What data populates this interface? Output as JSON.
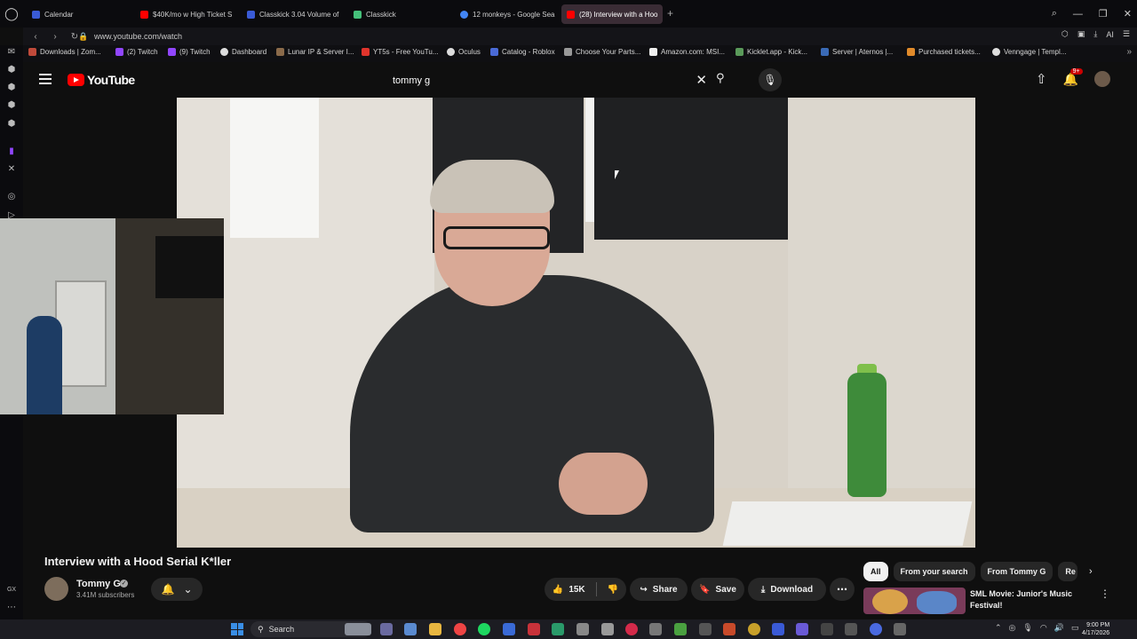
{
  "browser": {
    "tabs": [
      {
        "label": "Calendar",
        "color": "#3a5bd6"
      },
      {
        "label": "$40K/mo w High Ticket S",
        "color": "#ff0000"
      },
      {
        "label": "Classkick 3.04 Volume of",
        "color": "#3a5bd6"
      },
      {
        "label": "Classkick",
        "color": "#45c07a"
      },
      {
        "label": "12 monkeys - Google Sea",
        "color": "#4285f4"
      },
      {
        "label": "(28) Interview with a Hoo",
        "color": "#ff0000"
      }
    ],
    "url": "www.youtube.com/watch",
    "ai_label": "AI",
    "bookmarks": [
      {
        "label": "Downloads | Zom..."
      },
      {
        "label": "(2) Twitch"
      },
      {
        "label": "(9) Twitch"
      },
      {
        "label": "Dashboard"
      },
      {
        "label": "Lunar IP & Server I..."
      },
      {
        "label": "YT5s - Free YouTu..."
      },
      {
        "label": "Oculus"
      },
      {
        "label": "Catalog - Roblox"
      },
      {
        "label": "Choose Your Parts..."
      },
      {
        "label": "Amazon.com: MSI..."
      },
      {
        "label": "Kicklet.app - Kick..."
      },
      {
        "label": "Server | Aternos |..."
      },
      {
        "label": "Purchased tickets..."
      },
      {
        "label": "Venngage | Templ..."
      }
    ]
  },
  "youtube": {
    "logo_text": "YouTube",
    "search_value": "tommy g",
    "notification_badge": "9+",
    "video_title": "Interview with a Hood Serial K*ller",
    "channel_name": "Tommy G",
    "subscribers": "3.41M subscribers",
    "likes": "15K",
    "share_label": "Share",
    "save_label": "Save",
    "download_label": "Download",
    "chips": [
      "All",
      "From your search",
      "From Tommy G",
      "Re"
    ],
    "recommendation_title": "SML Movie: Junior's Music Festival!"
  },
  "taskbar": {
    "search_label": "Search",
    "time": "9:00 PM",
    "date": "4/17/2026"
  },
  "colors": {
    "youtube_red": "#ff0000",
    "background": "#0f0f0f",
    "chip_bg": "#272727"
  }
}
